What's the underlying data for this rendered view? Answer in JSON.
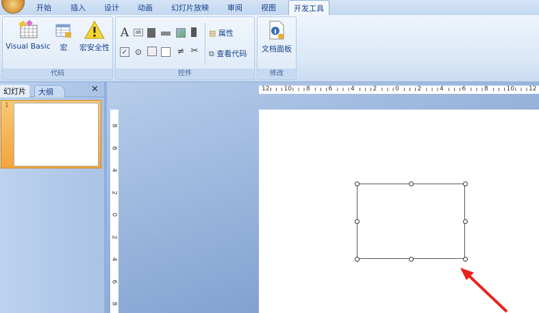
{
  "tabs": [
    "开始",
    "插入",
    "设计",
    "动画",
    "幻灯片放映",
    "审阅",
    "视图",
    "开发工具"
  ],
  "active_tab": "开发工具",
  "groups": {
    "code": {
      "label": "代码",
      "visual_basic": "Visual Basic",
      "macro": "宏",
      "macro_security": "宏安全性"
    },
    "controls": {
      "label": "控件",
      "properties": "属性",
      "view_code": "查看代码"
    },
    "modify": {
      "label": "修改",
      "document_panel": "文档面板"
    }
  },
  "panel": {
    "tab_slides": "幻灯片",
    "tab_outline": "大纲",
    "close": "✕",
    "slide_number": "1"
  },
  "hruler_labels": [
    "12",
    "10",
    "8",
    "6",
    "4",
    "2",
    "0",
    "2",
    "4",
    "6",
    "8",
    "10",
    "12"
  ],
  "vruler_labels": [
    "8",
    "6",
    "4",
    "2",
    "0",
    "2",
    "4",
    "6",
    "8"
  ],
  "colors": {
    "arrow": "#e8231c",
    "accent": "#15428b"
  }
}
